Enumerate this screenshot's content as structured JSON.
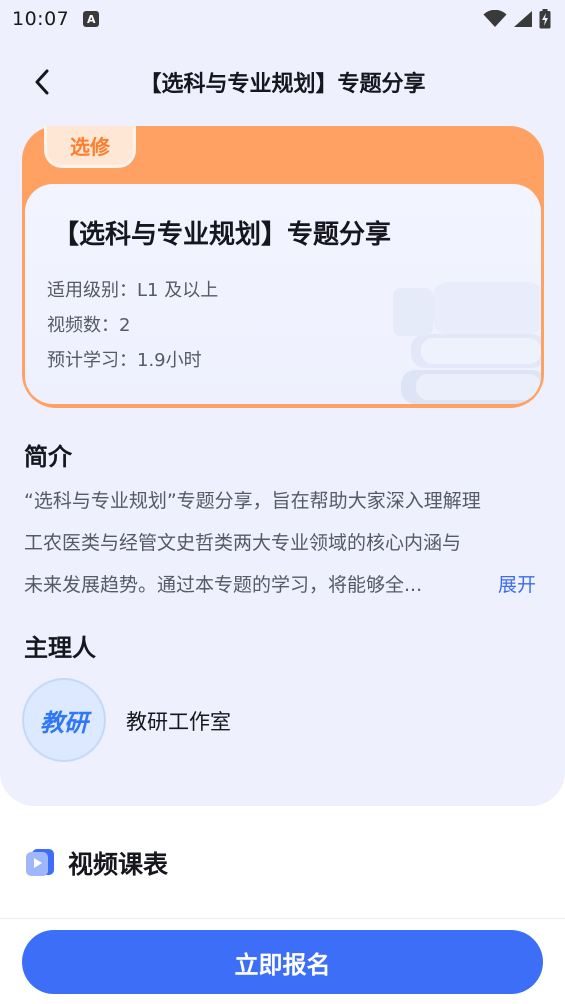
{
  "status_bar": {
    "time": "10:07",
    "notification_letter": "A"
  },
  "header": {
    "title": "【选科与专业规划】专题分享"
  },
  "course_card": {
    "tag": "选修",
    "title": "【选科与专业规划】专题分享",
    "level": "适用级别：L1 及以上",
    "video_count": "视频数：2",
    "estimated_time": "预计学习：1.9小时",
    "accent_color": "#ffa163"
  },
  "intro": {
    "title": "简介",
    "lines": [
      "“选科与专业规划”专题分享，旨在帮助大家深入理解理",
      "工农医类与经管文史哲类两大专业领域的核心内涵与",
      "未来发展趋势。通过本专题的学习，将能够全..."
    ],
    "expand_label": "展开"
  },
  "host": {
    "title": "主理人",
    "avatar_text": "教研",
    "name": "教研工作室"
  },
  "videos": {
    "title": "视频课表"
  },
  "actions": {
    "signup_label": "立即报名",
    "primary_color": "#3d6ef7"
  }
}
